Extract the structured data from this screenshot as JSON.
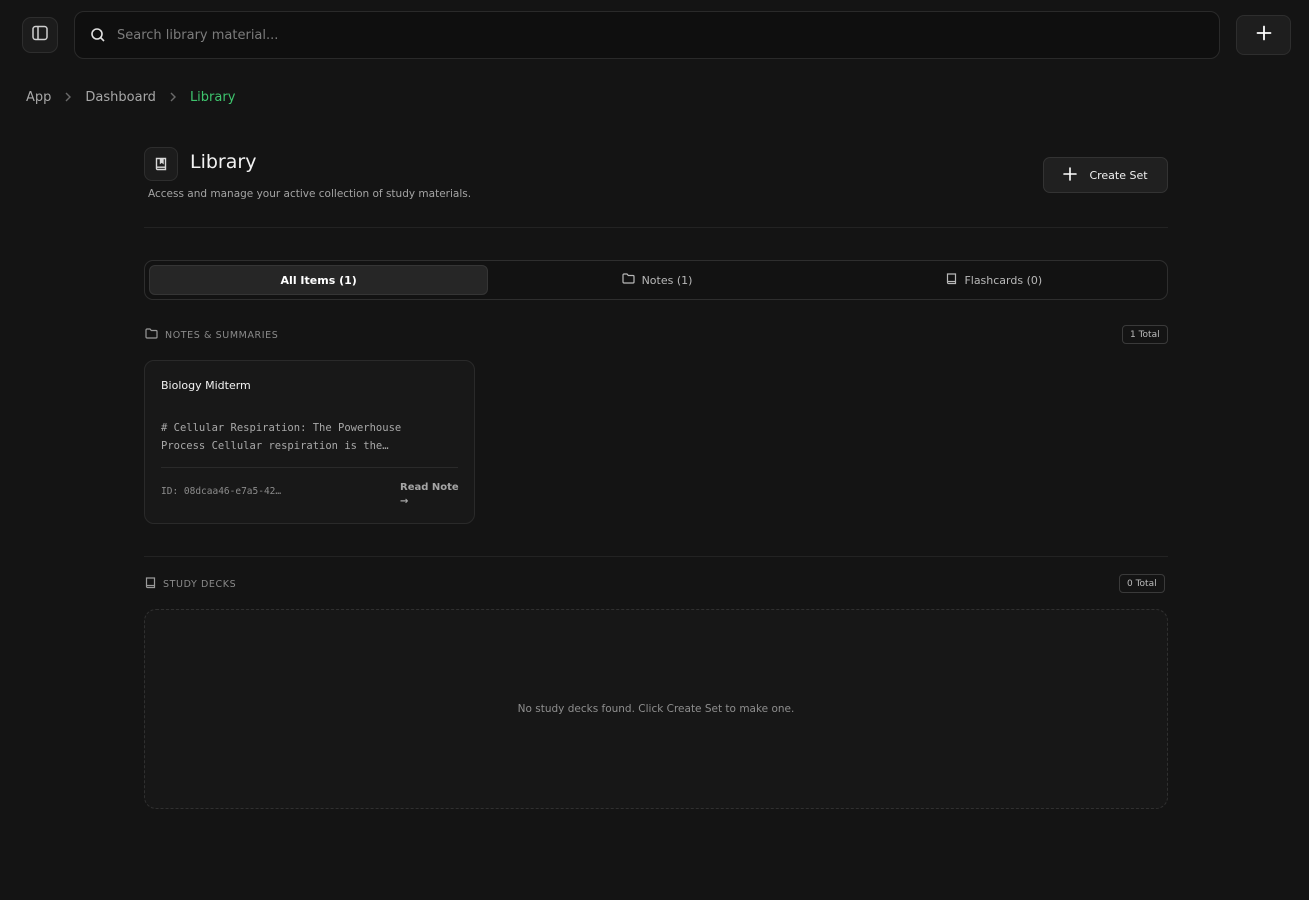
{
  "topbar": {
    "search_placeholder": "Search library material...",
    "sidebar_toggle_icon": "sidebar-panel-icon",
    "search_icon": "search-icon",
    "add_icon": "plus-icon"
  },
  "breadcrumb": {
    "items": [
      "App",
      "Dashboard",
      "Library"
    ],
    "current_color": "#3ec46d"
  },
  "header": {
    "title": "Library",
    "description": "Access and manage your active collection of study materials.",
    "icon": "book-icon",
    "create_label": "Create Set"
  },
  "tabs": [
    {
      "label": "All Items (1)",
      "active": true
    },
    {
      "label": "Notes (1)",
      "icon": "folder-icon"
    },
    {
      "label": "Flashcards (0)",
      "icon": "book-icon"
    }
  ],
  "notes_section": {
    "title": "NOTES & SUMMARIES",
    "count_label": "1 Total",
    "notes": [
      {
        "title": "Biology Midterm",
        "excerpt_line1": "# Cellular Respiration: The Powerhouse",
        "excerpt_line2": "Process Cellular respiration is the…",
        "id": "ID: 08dcaa46-e7a5-42…",
        "read_label": "Read Note",
        "read_arrow": "→"
      }
    ]
  },
  "decks_section": {
    "title": "STUDY DECKS",
    "count_label": "0 Total",
    "empty_text": "No study decks found. Click Create Set to make one."
  },
  "colors": {
    "background": "#141414",
    "accent_green": "#3ec46d"
  }
}
